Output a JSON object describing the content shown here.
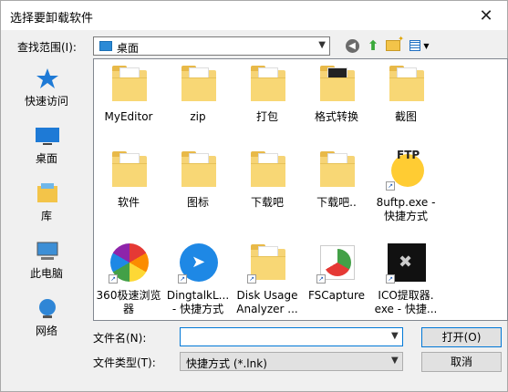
{
  "title": "选择要卸载软件",
  "lookin": {
    "label": "查找范围(I):",
    "value": "桌面"
  },
  "places": [
    {
      "label": "快速访问",
      "icon": "star-icon"
    },
    {
      "label": "桌面",
      "icon": "desktop-icon"
    },
    {
      "label": "库",
      "icon": "library-icon"
    },
    {
      "label": "此电脑",
      "icon": "computer-icon"
    },
    {
      "label": "网络",
      "icon": "network-icon"
    }
  ],
  "files": [
    {
      "name": "MyEditor",
      "kind": "folder"
    },
    {
      "name": "zip",
      "kind": "folder"
    },
    {
      "name": "打包",
      "kind": "folder"
    },
    {
      "name": "格式转换",
      "kind": "folder-dark"
    },
    {
      "name": "截图",
      "kind": "folder"
    },
    {
      "name": "软件",
      "kind": "folder"
    },
    {
      "name": "图标",
      "kind": "folder"
    },
    {
      "name": "下载吧",
      "kind": "folder"
    },
    {
      "name": "下载吧..",
      "kind": "folder"
    },
    {
      "name": "8uftp.exe -",
      "name2": "快捷方式",
      "kind": "ftp"
    },
    {
      "name": "360极速浏览",
      "name2": "器",
      "kind": "browser360"
    },
    {
      "name": "DingtalkL...",
      "name2": "- 快捷方式",
      "kind": "dingtalk"
    },
    {
      "name": "Disk Usage",
      "name2": "Analyzer ...",
      "kind": "disk"
    },
    {
      "name": "FSCapture",
      "kind": "fscapture"
    },
    {
      "name": "ICO提取器.",
      "name2": "exe - 快捷...",
      "kind": "ico"
    }
  ],
  "filename": {
    "label": "文件名(N):",
    "value": ""
  },
  "filetype": {
    "label": "文件类型(T):",
    "value": "快捷方式 (*.lnk)"
  },
  "buttons": {
    "open": "打开(O)",
    "cancel": "取消"
  }
}
